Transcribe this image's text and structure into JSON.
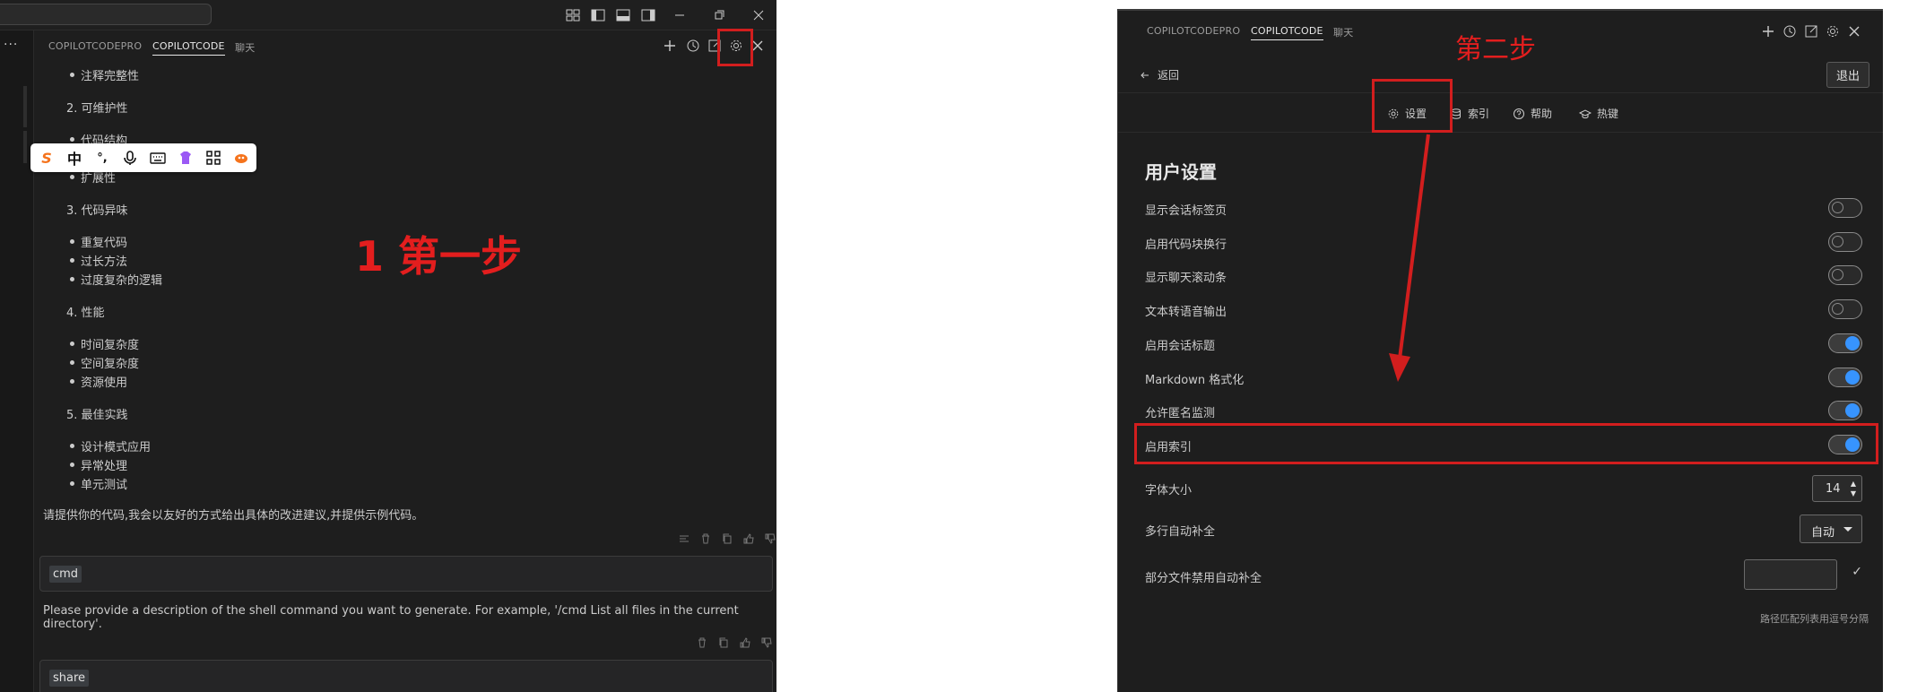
{
  "left": {
    "tabs": [
      "COPILOTCODEPRO",
      "COPILOTCODE",
      "聊天"
    ],
    "active_tab_index": 1,
    "gutter_more": "···",
    "chat": {
      "bullets_1": [
        "注释完整性"
      ],
      "heading_2": "2. 可维护性",
      "bullets_2": [
        "代码结构",
        "扩展性"
      ],
      "heading_3": "3. 代码异味",
      "bullets_3": [
        "重复代码",
        "过长方法",
        "过度复杂的逻辑"
      ],
      "heading_4": "4. 性能",
      "bullets_4": [
        "时间复杂度",
        "空间复杂度",
        "资源使用"
      ],
      "heading_5": "5. 最佳实践",
      "bullets_5": [
        "设计模式应用",
        "异常处理",
        "单元测试"
      ],
      "closing": "请提供你的代码,我会以友好的方式给出具体的改进建议,并提供示例代码。"
    },
    "cmd_label": "cmd",
    "cmd_text": "Please provide a description of the shell command you want to generate. For example, '/cmd List all files in the current directory'.",
    "share_label": "share",
    "ime": {
      "sogou": "S",
      "zh": "中",
      "punct": "°,"
    },
    "annotation": "1 第一步"
  },
  "right": {
    "tabs": [
      "COPILOTCODEPRO",
      "COPILOTCODE",
      "聊天"
    ],
    "active_tab_index": 1,
    "annotation": "第二步",
    "back_label": "返回",
    "exit_label": "退出",
    "subnav": [
      {
        "label": "设置",
        "icon": "gear-icon"
      },
      {
        "label": "索引",
        "icon": "database-icon"
      },
      {
        "label": "帮助",
        "icon": "help-icon"
      },
      {
        "label": "热键",
        "icon": "hat-icon"
      }
    ],
    "section_title": "用户设置",
    "toggles": [
      {
        "label": "显示会话标签页",
        "on": false
      },
      {
        "label": "启用代码块换行",
        "on": false
      },
      {
        "label": "显示聊天滚动条",
        "on": false
      },
      {
        "label": "文本转语音输出",
        "on": false
      },
      {
        "label": "启用会话标题",
        "on": true
      },
      {
        "label": "Markdown 格式化",
        "on": true
      },
      {
        "label": "允许匿名监测",
        "on": true
      },
      {
        "label": "启用索引",
        "on": true
      }
    ],
    "font_size_label": "字体大小",
    "font_size_value": "14",
    "multiline_label": "多行自动补全",
    "multiline_value": "自动",
    "disable_label": "部分文件禁用自动补全",
    "disable_value": "",
    "disable_hint": "路径匹配列表用逗号分隔",
    "accent": "#3794ff",
    "annotation_color": "#e31e1e"
  }
}
